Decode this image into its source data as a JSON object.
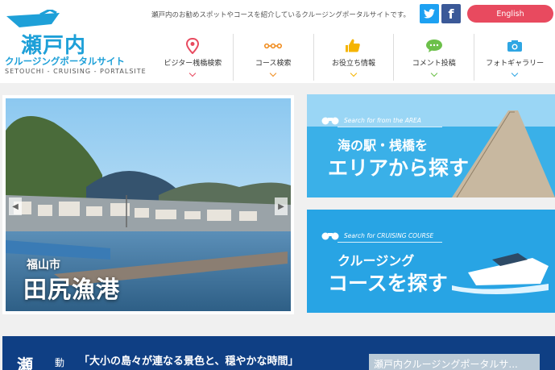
{
  "header": {
    "logo_title": "瀬戸内",
    "logo_subtitle": "クルージングポータルサイト",
    "logo_en": "SETOUCHI - CRUISING - PORTALSITE",
    "tagline": "瀬戸内のお勧めスポットやコースを紹介しているクルージングポータルサイトです。",
    "twitter_icon": "t",
    "facebook_icon": "f",
    "language_button": "English"
  },
  "nav": {
    "items": [
      {
        "label": "ビジター桟橋検索",
        "icon": "map-pin-icon"
      },
      {
        "label": "コース検索",
        "icon": "route-icon"
      },
      {
        "label": "お役立ち情報",
        "icon": "thumbs-up-icon"
      },
      {
        "label": "コメント投稿",
        "icon": "speech-bubble-icon"
      },
      {
        "label": "フォトギャラリー",
        "icon": "camera-icon"
      }
    ]
  },
  "slider": {
    "caption_sub": "福山市",
    "caption": "田尻漁港"
  },
  "banners": {
    "area": {
      "small": "Search for from the AREA",
      "title1": "海の駅・桟橋を",
      "title2": "エリアから探す"
    },
    "course": {
      "small": "Search for CRUISING COURSE",
      "title1": "クルージング",
      "title2": "コースを探す"
    }
  },
  "band": {
    "title": "瀬",
    "sub": "動",
    "quote": "「大小の島々が連なる景色と、穏やかな時間」",
    "thumb_text": "瀬戸内クルージングポータルサ..."
  },
  "colors": {
    "brand_blue": "#1ea0d8",
    "accent_red": "#e84a5f",
    "navy": "#0f3f84"
  }
}
